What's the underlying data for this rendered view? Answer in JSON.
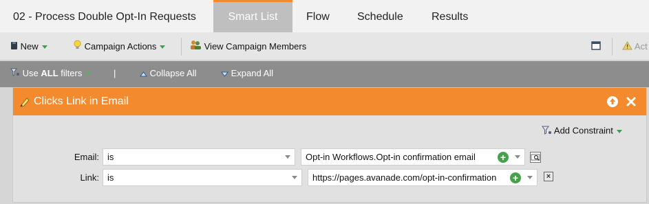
{
  "tabs": {
    "campaign_title": "02 - Process Double Opt-In Requests",
    "smart_list": "Smart List",
    "flow": "Flow",
    "schedule": "Schedule",
    "results": "Results",
    "active": "smart_list"
  },
  "toolbar": {
    "new_label": "New",
    "campaign_actions_label": "Campaign Actions",
    "view_members_label": "View Campaign Members",
    "actions_partial_label": "Act"
  },
  "filterbar": {
    "use_label": "Use",
    "all_label": "ALL",
    "filters_label": "filters",
    "separator": "|",
    "collapse_label": "Collapse All",
    "expand_label": "Expand All"
  },
  "filter": {
    "title": "Clicks Link in Email",
    "add_constraint_label": "Add Constraint",
    "rows": [
      {
        "label": "Email:",
        "operator": "is",
        "value": "Opt-in Workflows.Opt-in confirmation email"
      },
      {
        "label": "Link:",
        "operator": "is",
        "value": "https://pages.avanade.com/opt-in-confirmation"
      }
    ]
  },
  "colors": {
    "accent_orange": "#f48a2e",
    "filter_bar_gray": "#8d8d8d",
    "add_green": "#46a24a"
  }
}
